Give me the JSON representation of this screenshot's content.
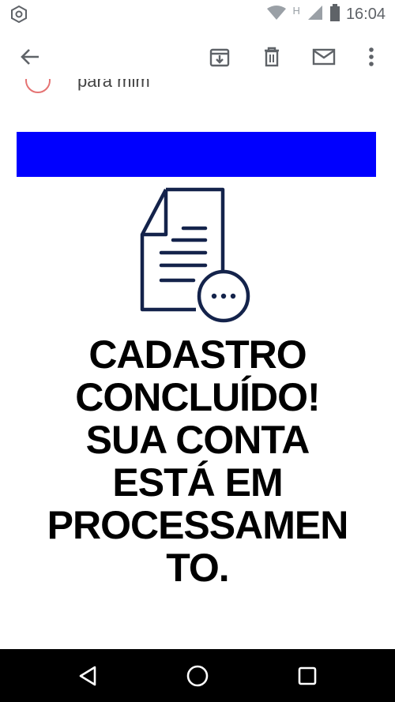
{
  "status_bar": {
    "time": "16:04",
    "network_letter": "H",
    "icons": [
      "settings-hexagon-icon",
      "wifi-icon",
      "signal-icon",
      "battery-icon"
    ]
  },
  "toolbar": {
    "icons": [
      "back-arrow-icon",
      "archive-icon",
      "delete-icon",
      "mail-icon",
      "more-vert-icon"
    ]
  },
  "email": {
    "recipient_partial": "para mim",
    "headline_lines": [
      "CADASTRO",
      "CONCLUÍDO!",
      "SUA CONTA",
      "ESTÁ EM",
      "PROCESSAMEN",
      "TO."
    ],
    "banner_color": "#0000ff",
    "illustration_color": "#14234b"
  },
  "nav_bar": {
    "icons": [
      "back-triangle-icon",
      "home-circle-icon",
      "recents-square-icon"
    ]
  }
}
